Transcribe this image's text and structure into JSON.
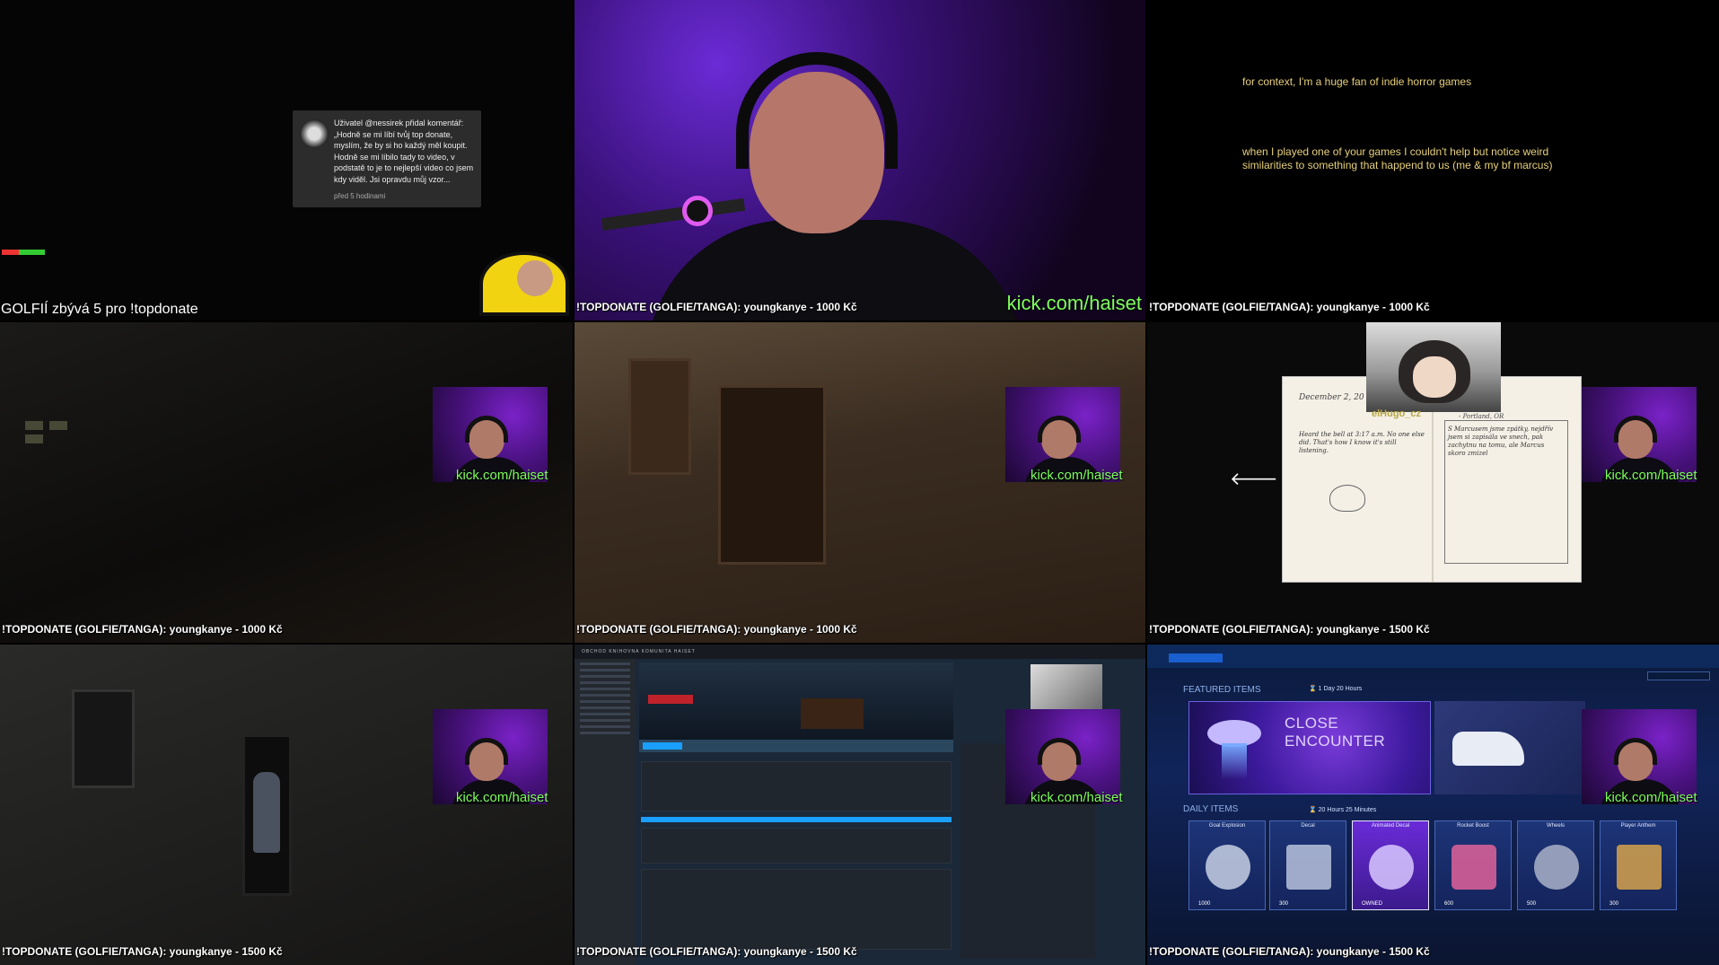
{
  "cells": {
    "c1": {
      "comment": {
        "text": "Uživatel @nessirek přidal komentář: „Hodně se mi líbí tvůj top donate, myslím, že by si ho každý měl koupit. Hodně se mi líbilo tady to video, v podstatě to je to nejlepší video co jsem kdy viděl. Jsi opravdu můj vzor...",
        "time": "před 5 hodinami"
      },
      "golf_text": "GOLFIÍ zbývá 5 pro !topdonate"
    },
    "c2": {
      "caption": "!TOPDONATE (GOLFIE/TANGA): youngkanye - 1000 Kč",
      "kick": "kick.com/haiset"
    },
    "c3": {
      "line1": "for context, I'm a huge fan of indie horror games",
      "line2": "when I played one of your games I couldn't help but notice weird",
      "line3": "similarities to something that happend to us (me & my bf marcus)",
      "caption": "!TOPDONATE (GOLFIE/TANGA): youngkanye - 1000 Kč"
    },
    "c4": {
      "caption": "!TOPDONATE (GOLFIE/TANGA): youngkanye - 1000 Kč",
      "kick": "kick.com/haiset"
    },
    "c5": {
      "caption": "!TOPDONATE (GOLFIE/TANGA): youngkanye - 1000 Kč",
      "kick": "kick.com/haiset"
    },
    "c6": {
      "caption": "!TOPDONATE (GOLFIE/TANGA): youngkanye - 1500 Kč",
      "kick": "kick.com/haiset",
      "diary_date": "December 2, 20",
      "diary_addr": "- Portland, OR",
      "diary_left": "Heard the bell at 3:17 a.m. No one else did. That's how I know it's still listening.",
      "diary_right": "S Marcusem jsme zpátky, nejdřív jsem si zapisála ve snech, pak zachytnu na tomu, ale Marcus skoro zmizel",
      "elhugo": "elHugo_cz",
      "arrow": "🡐"
    },
    "c7": {
      "caption": "!TOPDONATE (GOLFIE/TANGA): youngkanye - 1500 Kč",
      "kick": "kick.com/haiset"
    },
    "c8": {
      "caption": "!TOPDONATE (GOLFIE/TANGA): youngkanye - 1500 Kč",
      "kick": "kick.com/haiset",
      "topbar": "OBCHOD   KNIHOVNA   KOMUNITA   HAISET"
    },
    "c9": {
      "caption": "!TOPDONATE (GOLFIE/TANGA): youngkanye - 1500 Kč",
      "kick": "kick.com/haiset",
      "featured_label": "FEATURED ITEMS",
      "featured_timer": "⌛ 1 Day 20 Hours",
      "close_encounter": "CLOSE ENCOUNTER",
      "daily_label": "DAILY ITEMS",
      "daily_timer": "⌛ 20 Hours 25 Minutes",
      "items": [
        {
          "label": "Goal Explosion",
          "price": "1000"
        },
        {
          "label": "Decal",
          "price": "300"
        },
        {
          "label": "Animated Decal",
          "price": "OWNED"
        },
        {
          "label": "Rocket Boost",
          "price": "600"
        },
        {
          "label": "Wheels",
          "price": "500"
        },
        {
          "label": "Player Anthem",
          "price": "300"
        }
      ]
    }
  }
}
